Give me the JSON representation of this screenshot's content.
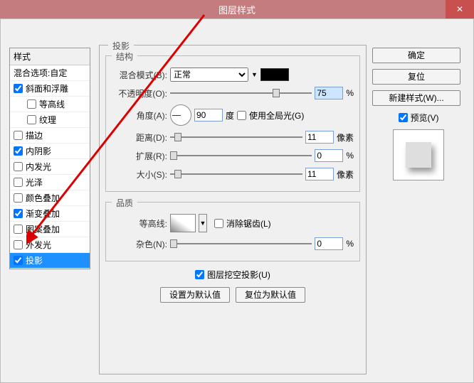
{
  "window": {
    "title": "图层样式"
  },
  "styles_list": {
    "header": "样式",
    "blend_options": "混合选项:自定",
    "bevel": "斜面和浮雕",
    "contour": "等高线",
    "texture": "纹理",
    "stroke": "描边",
    "inner_shadow": "内阴影",
    "inner_glow": "内发光",
    "satin": "光泽",
    "color_overlay": "颜色叠加",
    "gradient_overlay": "渐变叠加",
    "pattern_overlay": "图案叠加",
    "outer_glow": "外发光",
    "drop_shadow": "投影"
  },
  "panel": {
    "title": "投影",
    "structure": "结构",
    "blend_mode_label": "混合模式(B):",
    "blend_mode_value": "正常",
    "opacity_label": "不透明度(O):",
    "opacity_value": "75",
    "opacity_unit": "%",
    "angle_label": "角度(A):",
    "angle_value": "90",
    "angle_unit": "度",
    "global_light": "使用全局光(G)",
    "distance_label": "距离(D):",
    "distance_value": "11",
    "distance_unit": "像素",
    "spread_label": "扩展(R):",
    "spread_value": "0",
    "spread_unit": "%",
    "size_label": "大小(S):",
    "size_value": "11",
    "size_unit": "像素",
    "quality": "品质",
    "contour_label": "等高线:",
    "antialias": "消除锯齿(L)",
    "noise_label": "杂色(N):",
    "noise_value": "0",
    "noise_unit": "%",
    "knockout": "图层挖空投影(U)",
    "make_default": "设置为默认值",
    "reset_default": "复位为默认值"
  },
  "buttons": {
    "ok": "确定",
    "cancel": "复位",
    "new_style": "新建样式(W)...",
    "preview": "预览(V)"
  }
}
